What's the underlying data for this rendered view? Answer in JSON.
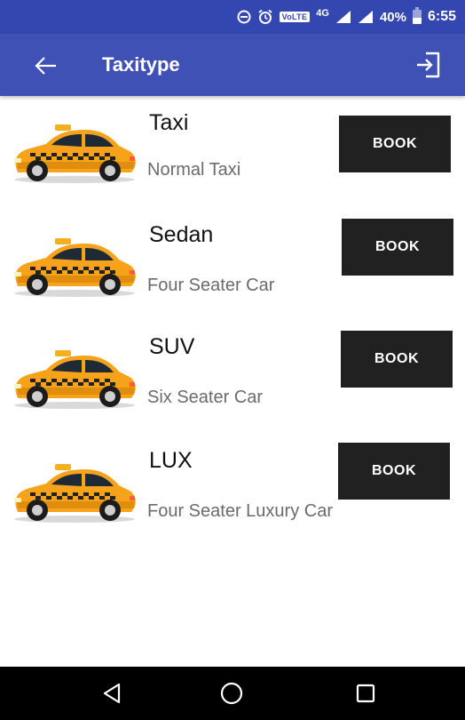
{
  "status_bar": {
    "volte_label": "VoLTE",
    "network_label": "4G",
    "battery_text": "40%",
    "time": "6:55"
  },
  "app_bar": {
    "title": "Taxitype",
    "back_icon": "arrow-left-icon",
    "logout_icon": "logout-icon"
  },
  "taxi_types": [
    {
      "name": "Taxi",
      "description": "Normal Taxi",
      "button_label": "BOOK"
    },
    {
      "name": "Sedan",
      "description": "Four Seater Car",
      "button_label": "BOOK"
    },
    {
      "name": "SUV",
      "description": "Six Seater Car",
      "button_label": "BOOK"
    },
    {
      "name": "LUX",
      "description": "Four Seater Luxury Car",
      "button_label": "BOOK"
    }
  ],
  "nav_bar": {
    "back_icon": "triangle-back-icon",
    "home_icon": "circle-home-icon",
    "recents_icon": "square-recents-icon"
  },
  "colors": {
    "status_bar": "#3447b0",
    "app_bar": "#3f51b5",
    "button": "#212121",
    "taxi_body": "#f7a21b"
  }
}
